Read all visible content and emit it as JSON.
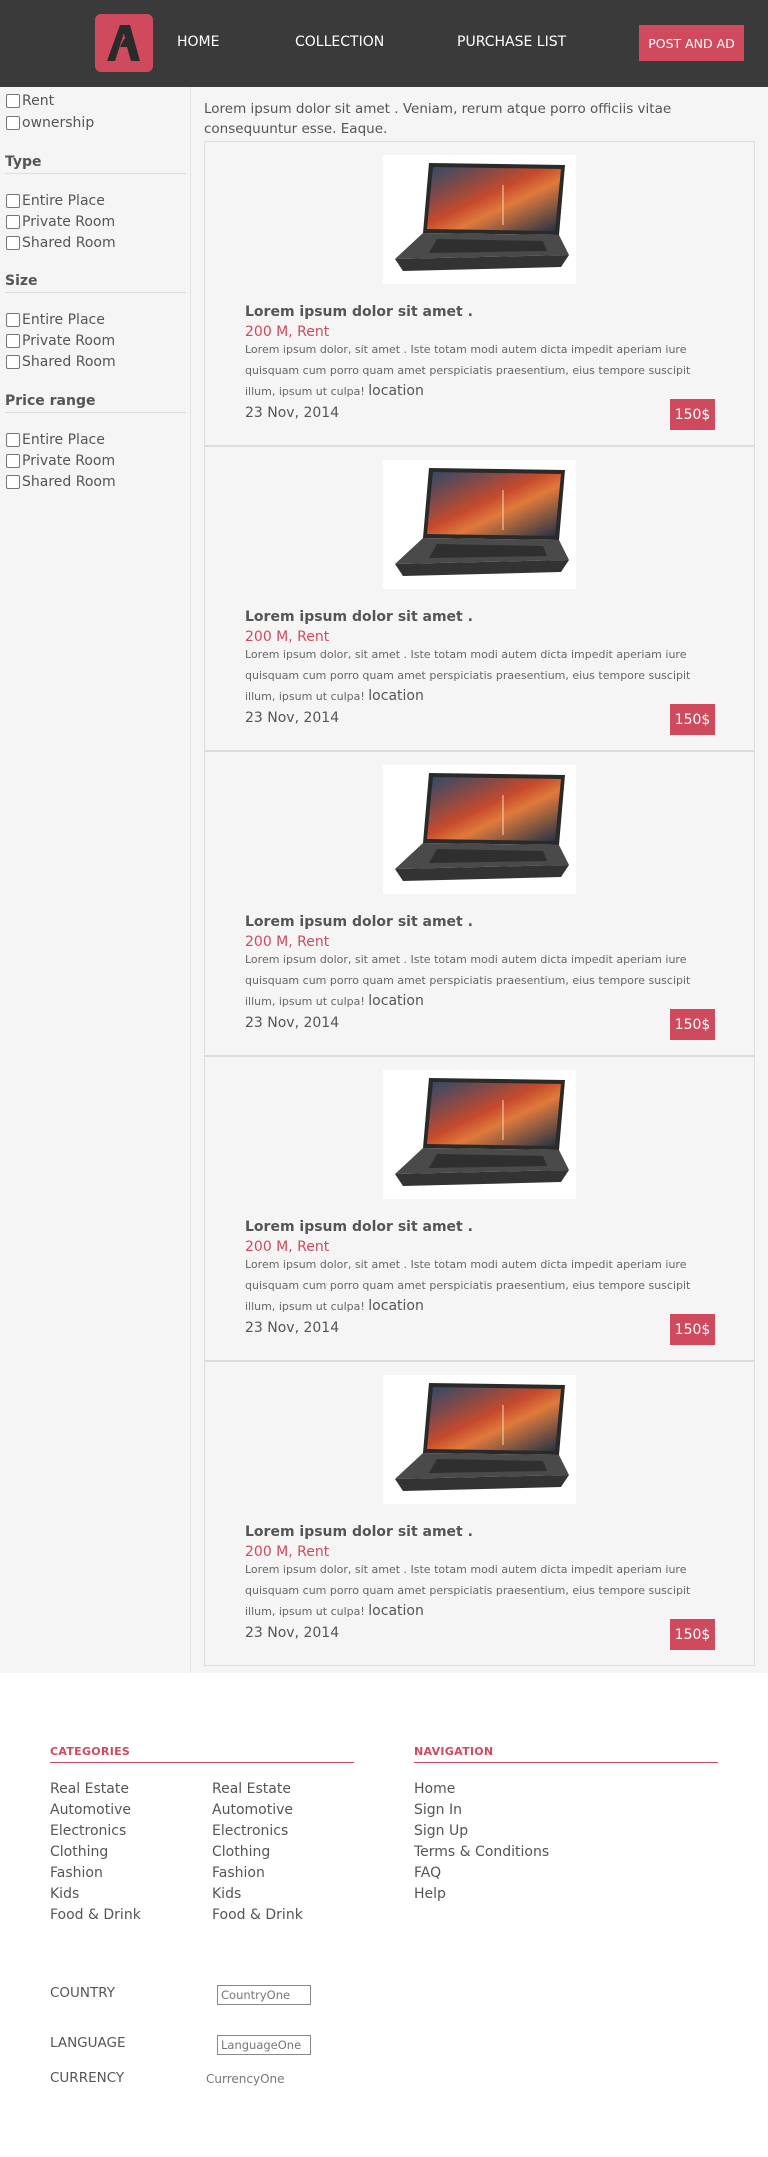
{
  "header": {
    "logo_letter": "A",
    "nav": [
      "HOME",
      "COLLECTION",
      "PURCHASE LIST"
    ],
    "post_button": "POST AND AD"
  },
  "sidebar": {
    "top_options": [
      "Rent",
      "ownership"
    ],
    "groups": [
      {
        "title": "Type",
        "options": [
          "Entire Place",
          "Private Room",
          "Shared Room"
        ]
      },
      {
        "title": "Size",
        "options": [
          "Entire Place",
          "Private Room",
          "Shared Room"
        ]
      },
      {
        "title": "Price range",
        "options": [
          "Entire Place",
          "Private Room",
          "Shared Room"
        ]
      }
    ]
  },
  "intro": "Lorem ipsum dolor sit amet . Veniam, rerum atque porro officiis vitae consequuntur esse. Eaque.",
  "listings": [
    {
      "title": "Lorem ipsum dolor sit amet .",
      "subtitle": "200 M, Rent",
      "description": "Lorem ipsum dolor, sit amet . Iste totam modi autem dicta impedit aperiam iure quisquam cum porro quam amet perspiciatis praesentium, eius tempore suscipit illum, ipsum ut culpa!",
      "location": "location",
      "date": "23 Nov, 2014",
      "price": "150$"
    },
    {
      "title": "Lorem ipsum dolor sit amet .",
      "subtitle": "200 M, Rent",
      "description": "Lorem ipsum dolor, sit amet . Iste totam modi autem dicta impedit aperiam iure quisquam cum porro quam amet perspiciatis praesentium, eius tempore suscipit illum, ipsum ut culpa!",
      "location": "location",
      "date": "23 Nov, 2014",
      "price": "150$"
    },
    {
      "title": "Lorem ipsum dolor sit amet .",
      "subtitle": "200 M, Rent",
      "description": "Lorem ipsum dolor, sit amet . Iste totam modi autem dicta impedit aperiam iure quisquam cum porro quam amet perspiciatis praesentium, eius tempore suscipit illum, ipsum ut culpa!",
      "location": "location",
      "date": "23 Nov, 2014",
      "price": "150$"
    },
    {
      "title": "Lorem ipsum dolor sit amet .",
      "subtitle": "200 M, Rent",
      "description": "Lorem ipsum dolor, sit amet . Iste totam modi autem dicta impedit aperiam iure quisquam cum porro quam amet perspiciatis praesentium, eius tempore suscipit illum, ipsum ut culpa!",
      "location": "location",
      "date": "23 Nov, 2014",
      "price": "150$"
    },
    {
      "title": "Lorem ipsum dolor sit amet .",
      "subtitle": "200 M, Rent",
      "description": "Lorem ipsum dolor, sit amet . Iste totam modi autem dicta impedit aperiam iure quisquam cum porro quam amet perspiciatis praesentium, eius tempore suscipit illum, ipsum ut culpa!",
      "location": "location",
      "date": "23 Nov, 2014",
      "price": "150$"
    }
  ],
  "footer": {
    "categories_title": "CATEGORIES",
    "categories_col1": [
      "Real Estate",
      "Automotive",
      "Electronics",
      "Clothing",
      "Fashion",
      "Kids",
      "Food & Drink"
    ],
    "categories_col2": [
      "Real Estate",
      "Automotive",
      "Electronics",
      "Clothing",
      "Fashion",
      "Kids",
      "Food & Drink"
    ],
    "navigation_title": "NAVIGATION",
    "navigation": [
      "Home",
      "Sign In",
      "Sign Up",
      "Terms & Conditions",
      "FAQ",
      "Help"
    ],
    "country_label": "COUNTRY",
    "country_value": "CountryOne",
    "language_label": "LANGUAGE",
    "language_value": "LanguageOne",
    "currency_label": "CURRENCY",
    "currency_value": "CurrencyOne"
  },
  "colors": {
    "accent": "#d04a5e",
    "header_bg": "#3a3a3a",
    "content_bg": "#f5f5f5"
  }
}
